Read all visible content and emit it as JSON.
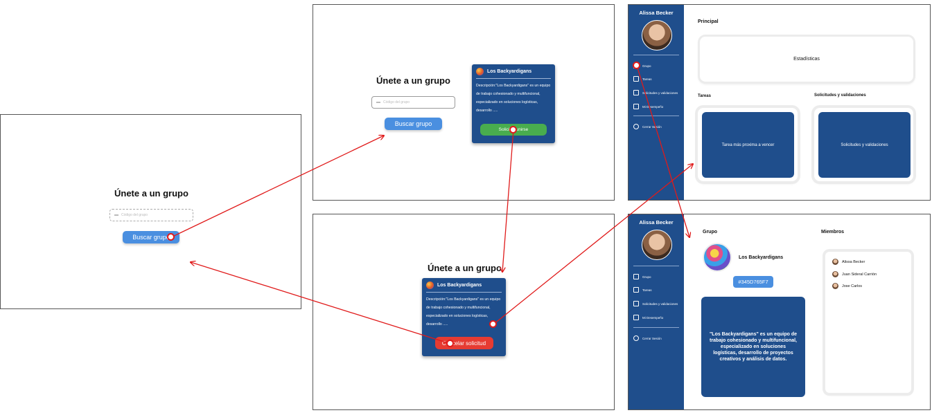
{
  "join_screen": {
    "title": "Únete a un grupo",
    "code_placeholder": "Código del grupo",
    "search_button": "Buscar grupo"
  },
  "group_card": {
    "name": "Los Backyardigans",
    "description_label": "Descripción:",
    "description": "\"Los Backyardigans\" es un equipo de trabajo cohesionado y multifuncional, especializado en soluciones logísticas, desarrollo .....",
    "join_button": "Solicitar unirse",
    "cancel_button": "Cancelar solicitud"
  },
  "sidebar": {
    "user_name": "Alissa Becker",
    "items": [
      {
        "label": "Grupo",
        "icon": "group-icon"
      },
      {
        "label": "Tareas",
        "icon": "document-icon"
      },
      {
        "label": "Solicitudes y validaciones",
        "icon": "mail-icon"
      },
      {
        "label": "Mi Desempeño",
        "icon": "chart-icon"
      },
      {
        "label": "Cerrar Sesión",
        "icon": "close-circle-icon"
      }
    ]
  },
  "dashboard": {
    "principal_heading": "Principal",
    "stats_label": "Estadísticas",
    "tasks_heading": "Tareas",
    "requests_heading": "Solicitudes y validaciones",
    "next_task_label": "Tarea más proxima a vencer",
    "requests_label": "Solicitudes y validaciones"
  },
  "group_page": {
    "group_heading": "Grupo",
    "members_heading": "Miembros",
    "group_name": "Los Backyardigans",
    "group_code": "#345D765F7",
    "group_description": "\"Los Backyardigans\" es un equipo de trabajo cohesionado y multifuncional, especializado en soluciones logísticas, desarrollo de proyectos creativos y análisis de datos.",
    "members": [
      "Alissa Becker",
      "Juan Sideral Carrión",
      "Jose Carlos"
    ]
  },
  "colors": {
    "brand_blue": "#1f4e8c",
    "button_blue": "#4a8fe0",
    "join_green": "#49ad4e",
    "cancel_red": "#e63b32",
    "arrow_red": "#e01a1a"
  }
}
